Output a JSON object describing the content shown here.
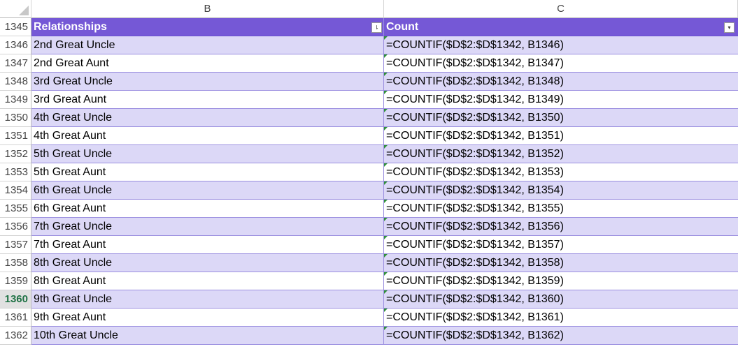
{
  "columns": [
    "B",
    "C"
  ],
  "header": {
    "row": "1345",
    "col_b": "Relationships",
    "col_c": "Count",
    "sort_icon": "sort-ascending-filter-icon",
    "filter_icon": "filter-dropdown-icon"
  },
  "active_row": "1360",
  "rows": [
    {
      "num": "1346",
      "b": "2nd Great Uncle",
      "c": "=COUNTIF($D$2:$D$1342, B1346)"
    },
    {
      "num": "1347",
      "b": "2nd Great Aunt",
      "c": "=COUNTIF($D$2:$D$1342, B1347)"
    },
    {
      "num": "1348",
      "b": "3rd Great Uncle",
      "c": "=COUNTIF($D$2:$D$1342, B1348)"
    },
    {
      "num": "1349",
      "b": "3rd Great Aunt",
      "c": "=COUNTIF($D$2:$D$1342, B1349)"
    },
    {
      "num": "1350",
      "b": "4th Great Uncle",
      "c": "=COUNTIF($D$2:$D$1342, B1350)"
    },
    {
      "num": "1351",
      "b": "4th Great Aunt",
      "c": "=COUNTIF($D$2:$D$1342, B1351)"
    },
    {
      "num": "1352",
      "b": "5th Great Uncle",
      "c": "=COUNTIF($D$2:$D$1342, B1352)"
    },
    {
      "num": "1353",
      "b": "5th Great Aunt",
      "c": "=COUNTIF($D$2:$D$1342, B1353)"
    },
    {
      "num": "1354",
      "b": "6th Great Uncle",
      "c": "=COUNTIF($D$2:$D$1342, B1354)"
    },
    {
      "num": "1355",
      "b": "6th Great Aunt",
      "c": "=COUNTIF($D$2:$D$1342, B1355)"
    },
    {
      "num": "1356",
      "b": "7th Great Uncle",
      "c": "=COUNTIF($D$2:$D$1342, B1356)"
    },
    {
      "num": "1357",
      "b": "7th Great Aunt",
      "c": "=COUNTIF($D$2:$D$1342, B1357)"
    },
    {
      "num": "1358",
      "b": "8th Great Uncle",
      "c": "=COUNTIF($D$2:$D$1342, B1358)"
    },
    {
      "num": "1359",
      "b": "8th Great Aunt",
      "c": "=COUNTIF($D$2:$D$1342, B1359)"
    },
    {
      "num": "1360",
      "b": "9th Great Uncle",
      "c": "=COUNTIF($D$2:$D$1342, B1360)"
    },
    {
      "num": "1361",
      "b": "9th Great Aunt",
      "c": "=COUNTIF($D$2:$D$1342, B1361)"
    },
    {
      "num": "1362",
      "b": "10th Great Uncle",
      "c": "=COUNTIF($D$2:$D$1342, B1362)"
    }
  ],
  "colors": {
    "header_bg": "#7558d6",
    "band_bg": "#dcd8f7",
    "active_row_text": "#217346"
  }
}
